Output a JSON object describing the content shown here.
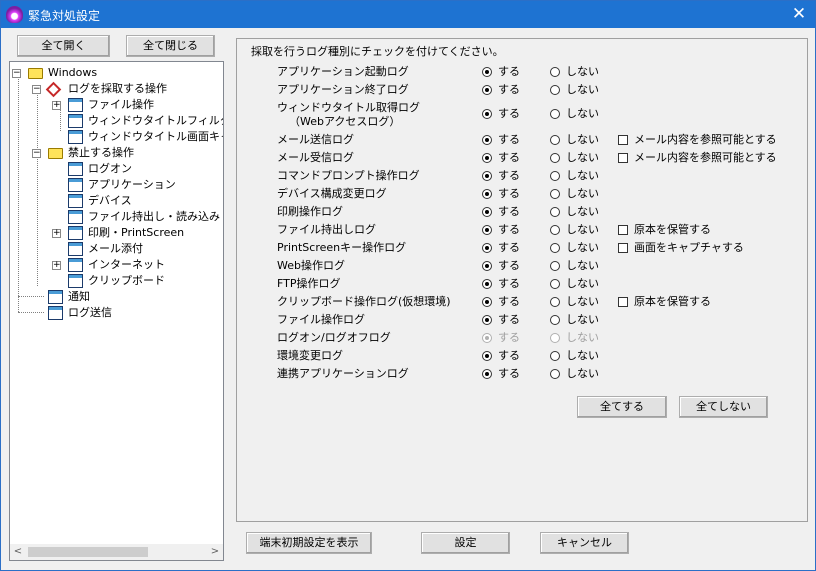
{
  "window": {
    "title": "緊急対処設定"
  },
  "tree_buttons": {
    "expand_all": "全て開く",
    "collapse_all": "全て閉じる"
  },
  "tree": {
    "root": "Windows",
    "collect": "ログを採取する操作",
    "collect_items": [
      "ファイル操作",
      "ウィンドウタイトルフィルタ",
      "ウィンドウタイトル画面キャ"
    ],
    "prohibit": "禁止する操作",
    "prohibit_items": [
      "ログオン",
      "アプリケーション",
      "デバイス",
      "ファイル持出し・読み込み",
      "印刷・PrintScreen",
      "メール添付",
      "インターネット",
      "クリップボード"
    ],
    "notify": "通知",
    "log_send": "ログ送信"
  },
  "panel": {
    "prompt": "採取を行うログ種別にチェックを付けてください。",
    "yes_label": "する",
    "no_label": "しない",
    "rows": [
      {
        "label": "アプリケーション起動ログ",
        "selected": "yes",
        "disabled": false,
        "check": ""
      },
      {
        "label": "アプリケーション終了ログ",
        "selected": "yes",
        "disabled": false,
        "check": ""
      },
      {
        "label": "ウィンドウタイトル取得ログ",
        "label2": "（Webアクセスログ）",
        "selected": "yes",
        "disabled": false,
        "check": ""
      },
      {
        "label": "メール送信ログ",
        "selected": "yes",
        "disabled": false,
        "check": "メール内容を参照可能とする"
      },
      {
        "label": "メール受信ログ",
        "selected": "yes",
        "disabled": false,
        "check": "メール内容を参照可能とする"
      },
      {
        "label": "コマンドプロンプト操作ログ",
        "selected": "yes",
        "disabled": false,
        "check": ""
      },
      {
        "label": "デバイス構成変更ログ",
        "selected": "yes",
        "disabled": false,
        "check": ""
      },
      {
        "label": "印刷操作ログ",
        "selected": "yes",
        "disabled": false,
        "check": ""
      },
      {
        "label": "ファイル持出しログ",
        "selected": "yes",
        "disabled": false,
        "check": "原本を保管する"
      },
      {
        "label": "PrintScreenキー操作ログ",
        "selected": "yes",
        "disabled": false,
        "check": "画面をキャプチャする"
      },
      {
        "label": "Web操作ログ",
        "selected": "yes",
        "disabled": false,
        "check": ""
      },
      {
        "label": "FTP操作ログ",
        "selected": "yes",
        "disabled": false,
        "check": ""
      },
      {
        "label": "クリップボード操作ログ(仮想環境)",
        "selected": "yes",
        "disabled": false,
        "check": "原本を保管する"
      },
      {
        "label": "ファイル操作ログ",
        "selected": "yes",
        "disabled": false,
        "check": ""
      },
      {
        "label": "ログオン/ログオフログ",
        "selected": "yes",
        "disabled": true,
        "check": ""
      },
      {
        "label": "環境変更ログ",
        "selected": "yes",
        "disabled": false,
        "check": ""
      },
      {
        "label": "連携アプリケーションログ",
        "selected": "yes",
        "disabled": false,
        "check": ""
      }
    ],
    "all_yes": "全てする",
    "all_no": "全てしない"
  },
  "footer": {
    "show_defaults": "端末初期設定を表示",
    "apply": "設定",
    "cancel": "キャンセル"
  },
  "colors": {
    "titlebar": "#1e73d2",
    "window_bg": "#f0f0f0"
  }
}
